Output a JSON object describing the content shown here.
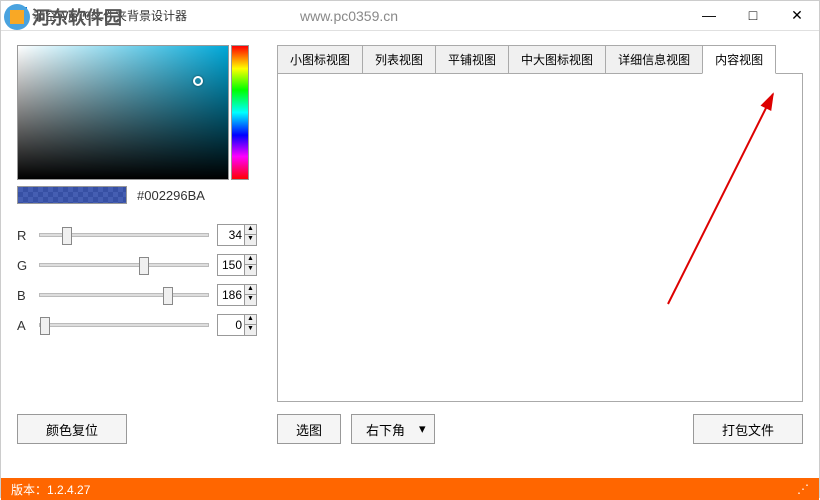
{
  "window": {
    "title": "非空Win10文件夹背景设计器",
    "minimize": "—",
    "maximize": "□",
    "close": "✕"
  },
  "color": {
    "hex": "#002296BA",
    "r": 34,
    "g": 150,
    "b": 186,
    "a": 0
  },
  "sliders": [
    {
      "label": "R",
      "pos": 13
    },
    {
      "label": "G",
      "pos": 59
    },
    {
      "label": "B",
      "pos": 73
    },
    {
      "label": "A",
      "pos": 0
    }
  ],
  "buttons": {
    "reset": "颜色复位",
    "choose": "选图",
    "position": "右下角",
    "pack": "打包文件"
  },
  "tabs": [
    "小图标视图",
    "列表视图",
    "平铺视图",
    "中大图标视图",
    "详细信息视图",
    "内容视图"
  ],
  "active_tab": 5,
  "footer": {
    "version_label": "版本：",
    "version": "1.2.4.27"
  },
  "watermark": {
    "text": "河东软件园",
    "url": "www.pc0359.cn"
  }
}
